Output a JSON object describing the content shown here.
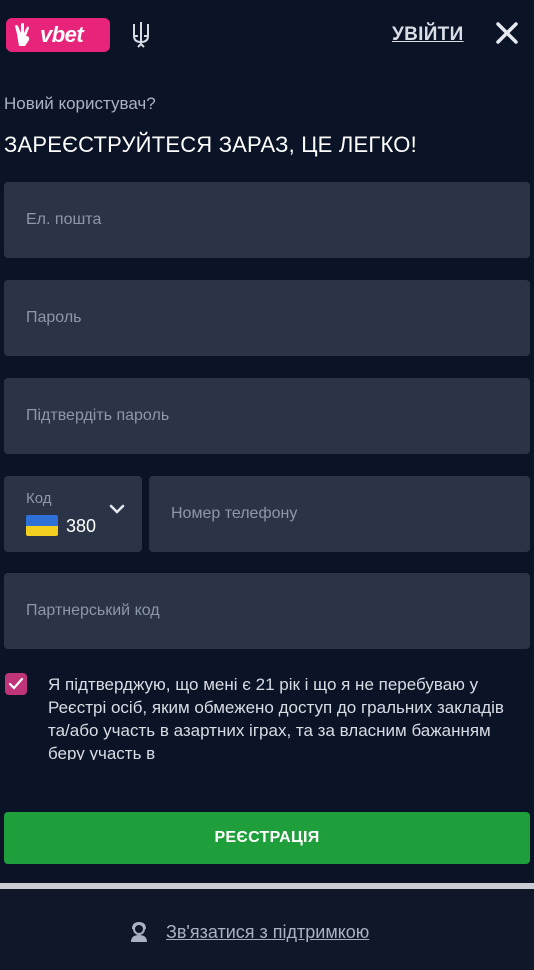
{
  "header": {
    "brand": "vbet",
    "login_label": "УВІЙТИ"
  },
  "form": {
    "subtitle": "Новий користувач?",
    "title": "ЗАРЕЄСТРУЙТЕСЯ ЗАРАЗ, ЦЕ ЛЕГКО!",
    "email_placeholder": "Ел. пошта",
    "password_placeholder": "Пароль",
    "confirm_password_placeholder": "Підтвердіть пароль",
    "code_label": "Код",
    "code_value": "380",
    "phone_placeholder": "Номер телефону",
    "partner_code_placeholder": "Партнерський код",
    "consent_checked": true,
    "consent_text": "Я підтверджую, що мені є 21 рік і що я не перебуваю у Реєстрі осіб, яким обмежено доступ до гральних закладів та/або участь в азартних іграх, та за власним бажанням беру участь в",
    "register_label": "РЕЄСТРАЦІЯ"
  },
  "footer": {
    "support_label": "Зв'язатися з підтримкою"
  },
  "colors": {
    "background": "#0b1326",
    "field": "#2a3446",
    "brand": "#e8247a",
    "checkbox": "#c0357a",
    "register": "#1e9f3c"
  }
}
